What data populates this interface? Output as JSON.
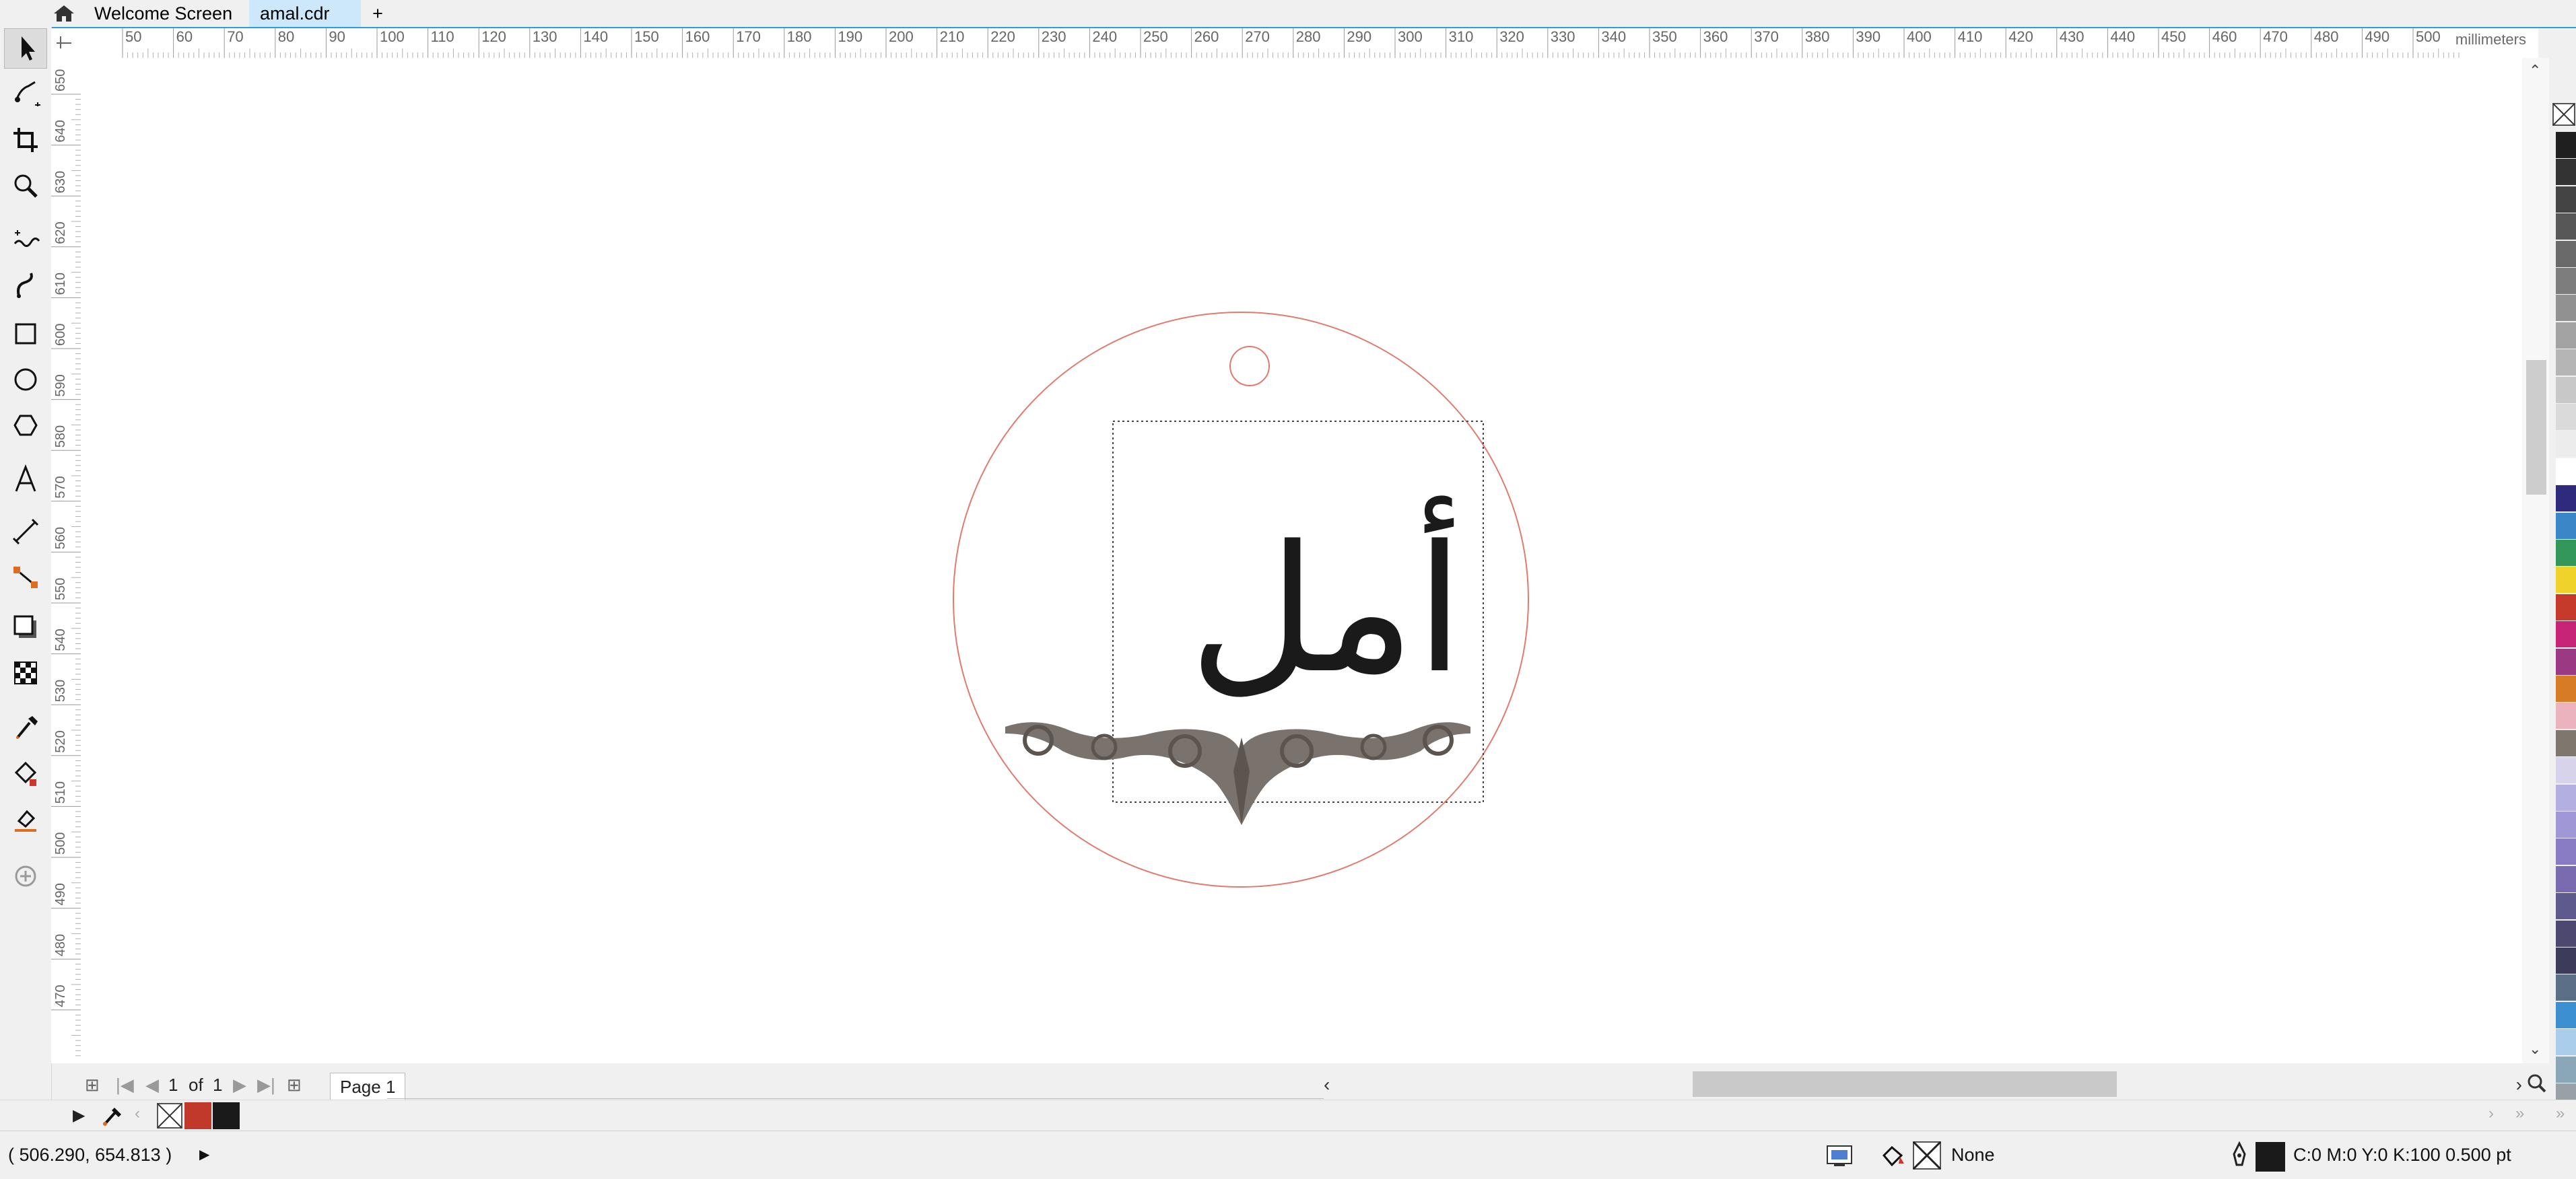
{
  "tabs": {
    "home_icon": "home-icon",
    "welcome_label": "Welcome Screen",
    "document_label": "amal.cdr",
    "add_label": "+"
  },
  "toolbox": {
    "tools": [
      "pick-tool",
      "freehand-pick-tool",
      "crop-tool",
      "zoom-tool",
      "freehand-tool",
      "artistic-media-tool",
      "rectangle-tool",
      "ellipse-tool",
      "polygon-tool",
      "text-tool",
      "parallel-dimension-tool",
      "connector-tool",
      "drop-shadow-tool",
      "transparency-tool",
      "eyedropper-tool",
      "interactive-fill-tool",
      "smart-fill-tool",
      "add-tool"
    ]
  },
  "rulers": {
    "unit": "millimeters",
    "h_ticks": [
      "50",
      "60",
      "70",
      "80",
      "90",
      "100",
      "110",
      "120",
      "130",
      "140",
      "150",
      "160",
      "170",
      "180",
      "190",
      "200",
      "210",
      "220",
      "230",
      "240",
      "250",
      "260",
      "270",
      "280",
      "290",
      "300",
      "310",
      "320",
      "330",
      "340",
      "350",
      "360",
      "370",
      "380",
      "390",
      "400",
      "410",
      "420",
      "430",
      "440",
      "450",
      "460",
      "470",
      "480",
      "490",
      "500"
    ],
    "v_ticks": [
      "650",
      "640",
      "630",
      "620",
      "610",
      "600",
      "590",
      "580",
      "570",
      "560",
      "550",
      "540",
      "530",
      "520",
      "510",
      "500",
      "490",
      "480",
      "470"
    ]
  },
  "canvas": {
    "text": "أمل",
    "colors": {
      "outline": "#e07b6f",
      "ornament": "#7a726c",
      "text": "#1a1a1a"
    }
  },
  "pagenav": {
    "current": "1",
    "of_label": "of",
    "total": "1",
    "page_tab": "Page 1"
  },
  "status": {
    "coords": "( 506.290, 654.813 )",
    "fill_label": "None",
    "outline_label": "C:0 M:0 Y:0 K:100  0.500 pt"
  },
  "palette": {
    "colors": [
      "#1f1f1f",
      "#333333",
      "#444444",
      "#575757",
      "#6a6a6a",
      "#7d7d7d",
      "#919191",
      "#a3a3a3",
      "#b5b5b5",
      "#c8c8c8",
      "#dadada",
      "#ececec",
      "#ffffff",
      "#2e2a7c",
      "#3b86c6",
      "#34975a",
      "#f0d32a",
      "#c63a2b",
      "#c72476",
      "#9b3a83",
      "#d77b24",
      "#eab3be",
      "#7f776d",
      "#d6d3ea",
      "#b3afe0",
      "#9f97d6",
      "#8a7cc4",
      "#7a6bb0",
      "#5f5a8e",
      "#4c4870",
      "#3d3b5a",
      "#5b6f86",
      "#3c8fd0",
      "#a9cdea",
      "#8aa7b8",
      "#98a1a6",
      "#7c868b"
    ],
    "doc_colors": [
      "#c0392b",
      "#1a1a1a"
    ]
  }
}
